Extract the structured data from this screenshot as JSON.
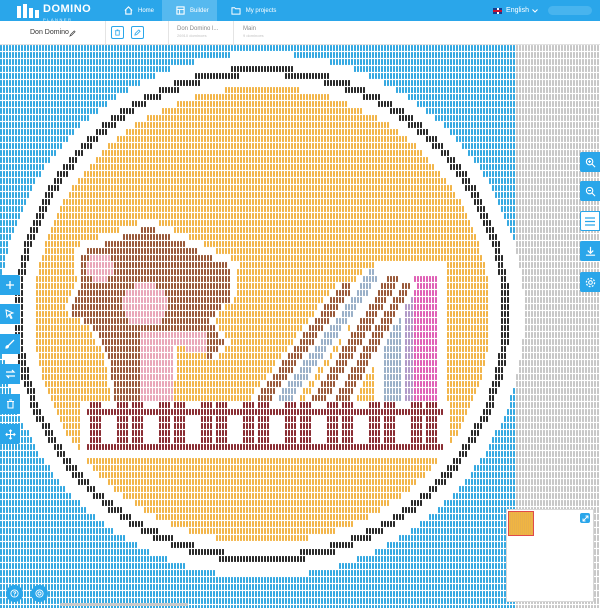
{
  "header": {
    "logo_text": "DOMINO",
    "logo_subtext": "PLANNER",
    "nav": [
      {
        "label": "Home",
        "icon": "home-icon"
      },
      {
        "label": "Builder",
        "icon": "builder-icon"
      },
      {
        "label": "My projects",
        "icon": "folder-icon"
      }
    ],
    "language": "English"
  },
  "project": {
    "name": "Don Domino",
    "breadcrumbs": [
      {
        "title": "Don Domino l...",
        "subtitle": "26910 dominoes"
      },
      {
        "title": "Main",
        "subtitle": "9 dominoes"
      }
    ]
  },
  "mosaic": {
    "colors": {
      "blue": "#36a9e1",
      "gray": "#c8c8c8",
      "white": "#ffffff",
      "black": "#2a2a2a",
      "orange": "#f2b54a",
      "maroon": "#8a2e34",
      "pink": "#e9a7b8",
      "brown": "#9a5a3a",
      "steel": "#9ab0c8",
      "magenta": "#e062b6",
      "lavender": "#b19ac8"
    }
  },
  "tools": {
    "right": [
      "zoom-in-icon",
      "zoom-out-icon",
      "menu-icon",
      "download-icon",
      "settings-icon"
    ],
    "left": [
      "add-icon",
      "select-icon",
      "brush-icon",
      "swap-icon",
      "trash-icon",
      "move-icon"
    ],
    "bottom": [
      "help-icon",
      "support-icon"
    ]
  }
}
